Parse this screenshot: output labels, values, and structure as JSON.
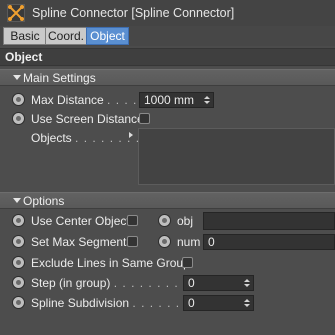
{
  "window": {
    "title": "Spline Connector [Spline Connector]",
    "icon": "spline-connector-icon"
  },
  "tabs": [
    {
      "label": "Basic",
      "active": false
    },
    {
      "label": "Coord.",
      "active": false
    },
    {
      "label": "Object",
      "active": true
    }
  ],
  "section": {
    "title": "Object"
  },
  "main_settings": {
    "header": "Main Settings",
    "max_distance": {
      "label": "Max Distance",
      "dots": ". . . . . .",
      "value": "1000 mm"
    },
    "use_screen_distance": {
      "label": "Use Screen Distance",
      "checked": false
    },
    "objects": {
      "label": "Objects",
      "dots": ". . . . . . . . ."
    }
  },
  "options": {
    "header": "Options",
    "use_center_object": {
      "label": "Use Center Object",
      "checked": false
    },
    "obj": {
      "label": "obj",
      "value": ""
    },
    "set_max_segments": {
      "label": "Set Max Segments",
      "checked": false
    },
    "num": {
      "label": "num",
      "value": "0"
    },
    "exclude_lines": {
      "label": "Exclude Lines in Same Group",
      "checked": false
    },
    "step": {
      "label": "Step (in group)",
      "dots": ". . . . . . . . . . .",
      "value": "0"
    },
    "spline_subdivision": {
      "label": "Spline Subdivision",
      "dots": ". . . . . . . . .",
      "value": "0"
    }
  },
  "colors": {
    "background": "#4b4b4b",
    "tab_active": "#5a8fd1",
    "field_bg": "#333333"
  }
}
